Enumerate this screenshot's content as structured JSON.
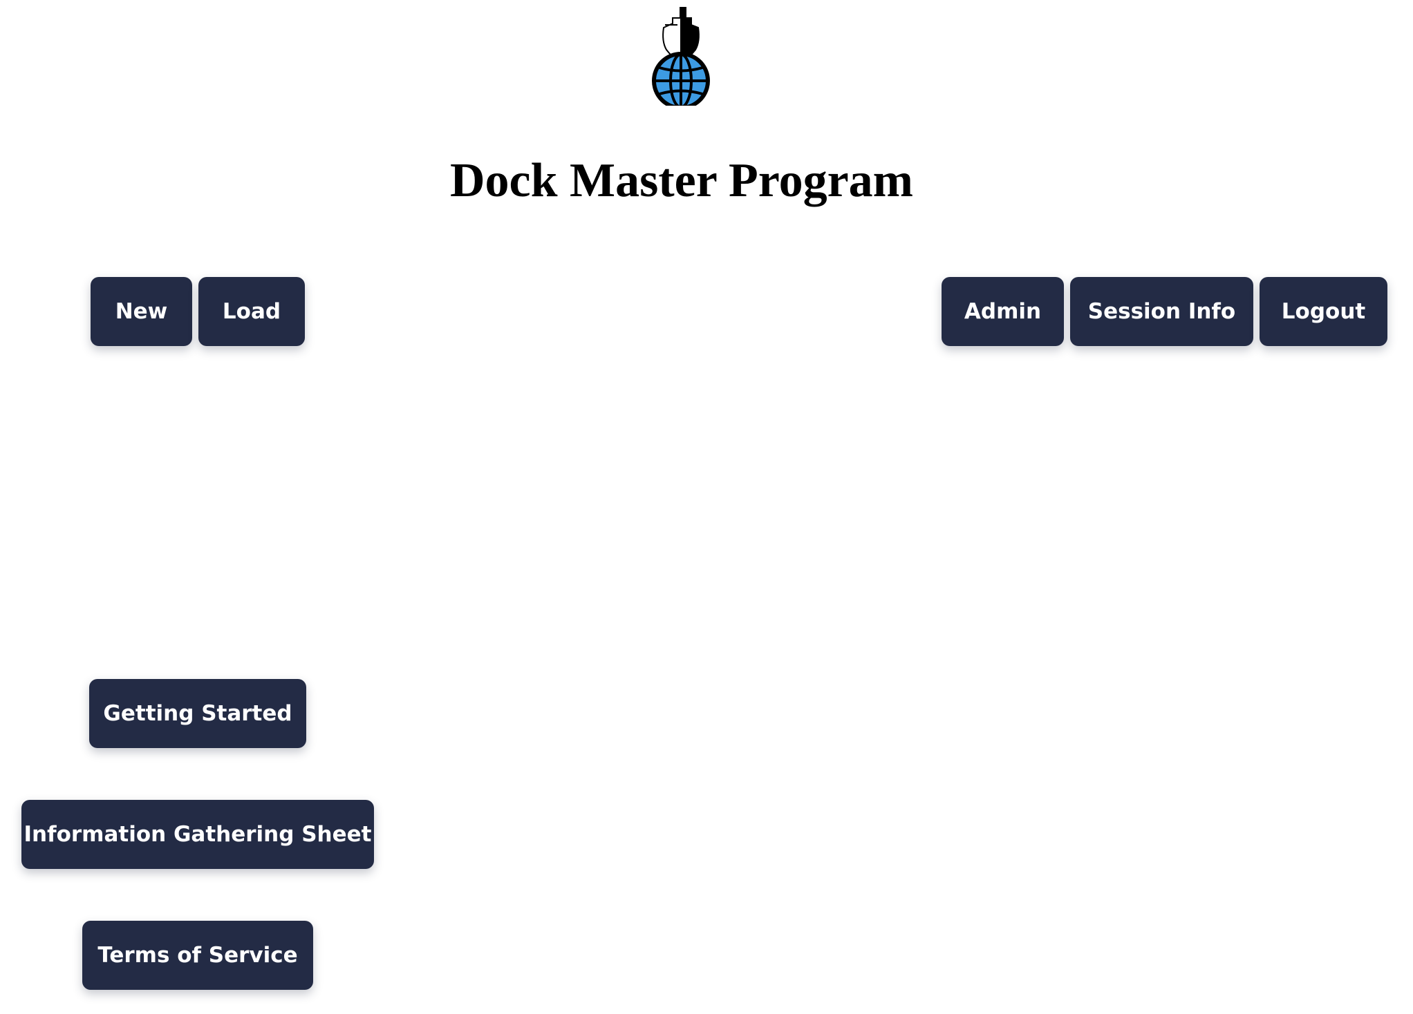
{
  "header": {
    "logo_icon": "ship-globe-logo-icon",
    "title": "Dock Master Program"
  },
  "toolbar_left": {
    "new_label": "New",
    "load_label": "Load"
  },
  "toolbar_right": {
    "admin_label": "Admin",
    "session_info_label": "Session Info",
    "logout_label": "Logout"
  },
  "links": {
    "getting_started_label": "Getting Started",
    "info_sheet_label": "Information Gathering Sheet",
    "terms_label": "Terms of Service"
  },
  "colors": {
    "button_background": "#232b45",
    "button_text": "#ffffff",
    "globe_blue": "#3d9be3"
  }
}
